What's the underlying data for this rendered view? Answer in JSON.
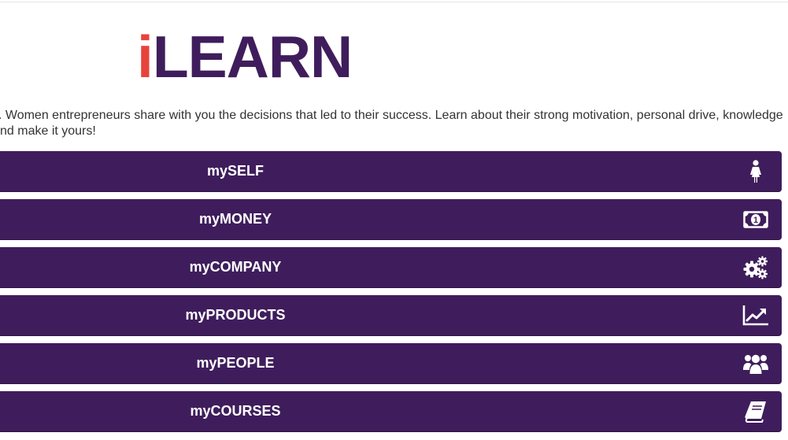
{
  "logo": {
    "accent": "i",
    "rest": "LEARN",
    "accent_color": "#e8433b",
    "brand_color": "#3f1d5c"
  },
  "intro": {
    "line1": ". Women entrepreneurs share with you the decisions that led to their success. Learn about their strong motivation, personal drive, knowledge",
    "line2": "nd make it yours!"
  },
  "menu": {
    "items": [
      {
        "label": "mySELF",
        "icon": "woman-icon"
      },
      {
        "label": "myMONEY",
        "icon": "money-icon"
      },
      {
        "label": "myCOMPANY",
        "icon": "gears-icon"
      },
      {
        "label": "myPRODUCTS",
        "icon": "line-chart-icon"
      },
      {
        "label": "myPEOPLE",
        "icon": "users-icon"
      },
      {
        "label": "myCOURSES",
        "icon": "book-icon"
      }
    ]
  }
}
